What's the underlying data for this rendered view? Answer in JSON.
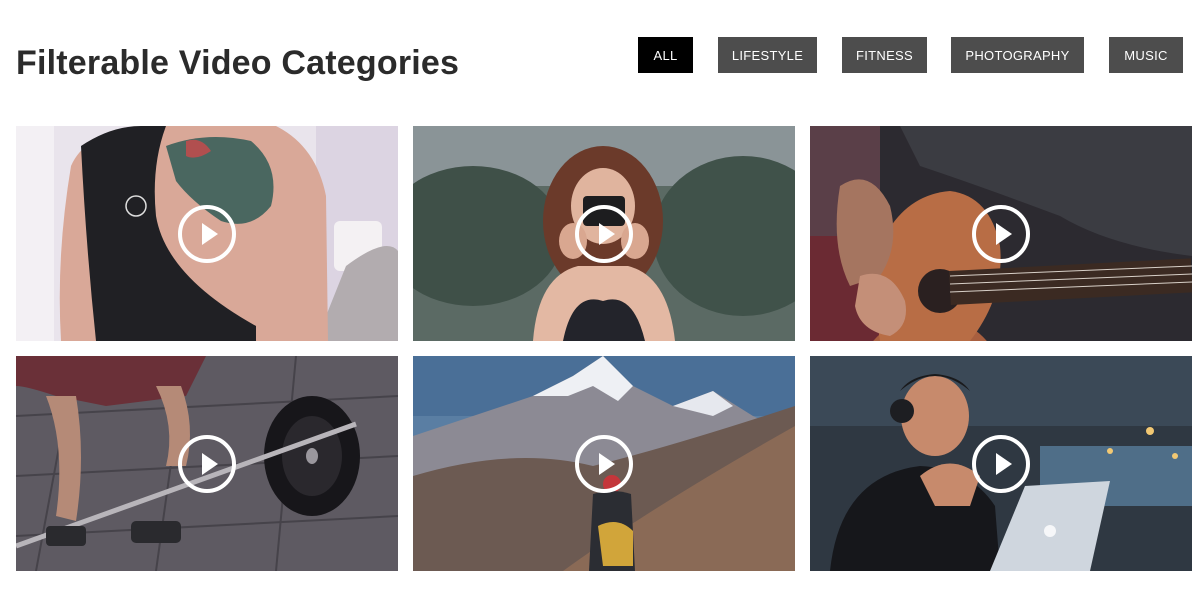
{
  "page": {
    "title": "Filterable Video Categories"
  },
  "filters": [
    {
      "label": "ALL",
      "active": true
    },
    {
      "label": "LIFESTYLE",
      "active": false
    },
    {
      "label": "FITNESS",
      "active": false
    },
    {
      "label": "PHOTOGRAPHY",
      "active": false
    },
    {
      "label": "MUSIC",
      "active": false
    }
  ],
  "videos": [
    {
      "thumbnail": "woman-tattoo-back",
      "icon": "play-icon"
    },
    {
      "thumbnail": "woman-camera-photographer",
      "icon": "play-icon"
    },
    {
      "thumbnail": "man-playing-guitar",
      "icon": "play-icon"
    },
    {
      "thumbnail": "barbell-weightlifting",
      "icon": "play-icon"
    },
    {
      "thumbnail": "mountain-hiker",
      "icon": "play-icon"
    },
    {
      "thumbnail": "man-headphones-laptop",
      "icon": "play-icon"
    }
  ],
  "colors": {
    "active_filter": "#000000",
    "filter": "#4d4d4d",
    "title": "#2b2b2b"
  }
}
